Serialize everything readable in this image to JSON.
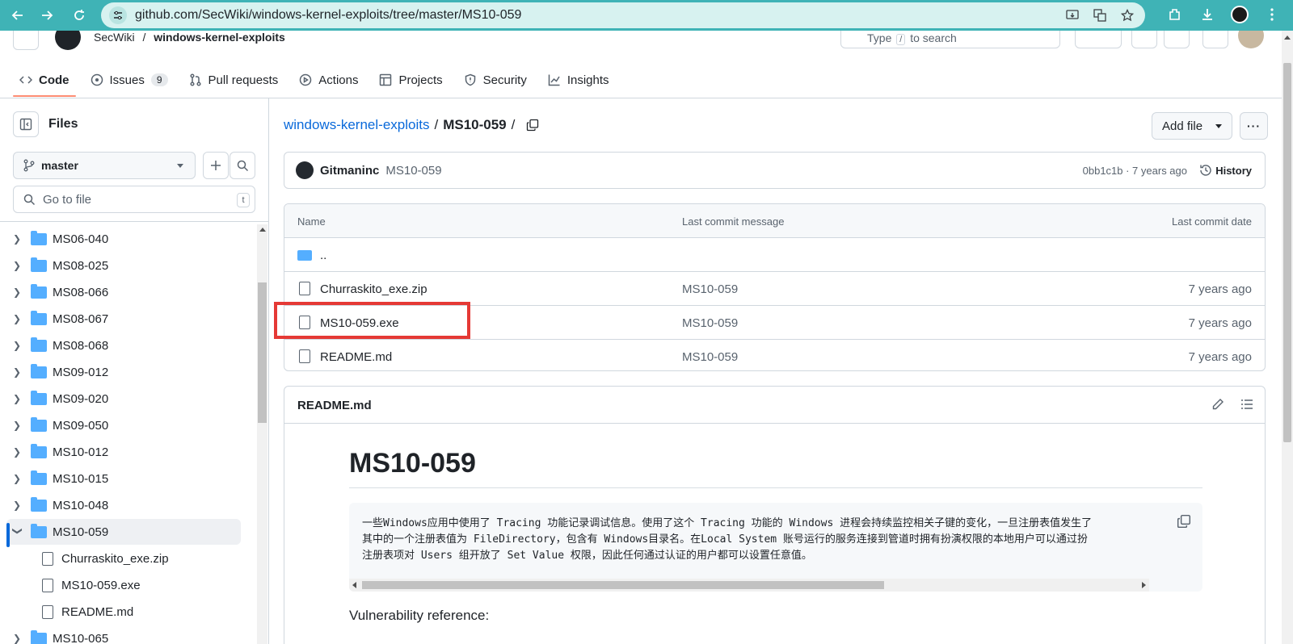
{
  "browser": {
    "url": "github.com/SecWiki/windows-kernel-exploits/tree/master/MS10-059"
  },
  "header": {
    "owner": "SecWiki",
    "separator": "/",
    "repo": "windows-kernel-exploits",
    "search_placeholder_start": "Type",
    "search_key": "/",
    "search_placeholder_end": "to search"
  },
  "tabs": [
    {
      "label": "Code",
      "icon": "code-icon"
    },
    {
      "label": "Issues",
      "icon": "issue-icon",
      "count": "9"
    },
    {
      "label": "Pull requests",
      "icon": "pull-request-icon"
    },
    {
      "label": "Actions",
      "icon": "play-icon"
    },
    {
      "label": "Projects",
      "icon": "table-icon"
    },
    {
      "label": "Security",
      "icon": "shield-icon"
    },
    {
      "label": "Insights",
      "icon": "graph-icon"
    }
  ],
  "sidebar": {
    "title": "Files",
    "branch": "master",
    "goto_placeholder": "Go to file",
    "goto_shortcut": "t",
    "items": [
      {
        "label": "MS06-040",
        "type": "folder"
      },
      {
        "label": "MS08-025",
        "type": "folder"
      },
      {
        "label": "MS08-066",
        "type": "folder"
      },
      {
        "label": "MS08-067",
        "type": "folder"
      },
      {
        "label": "MS08-068",
        "type": "folder"
      },
      {
        "label": "MS09-012",
        "type": "folder"
      },
      {
        "label": "MS09-020",
        "type": "folder"
      },
      {
        "label": "MS09-050",
        "type": "folder"
      },
      {
        "label": "MS10-012",
        "type": "folder"
      },
      {
        "label": "MS10-015",
        "type": "folder"
      },
      {
        "label": "MS10-048",
        "type": "folder"
      },
      {
        "label": "MS10-059",
        "type": "folder-open"
      },
      {
        "label": "Churraskito_exe.zip",
        "type": "file"
      },
      {
        "label": "MS10-059.exe",
        "type": "file"
      },
      {
        "label": "README.md",
        "type": "file"
      },
      {
        "label": "MS10-065",
        "type": "folder"
      }
    ]
  },
  "main": {
    "repo_link": "windows-kernel-exploits",
    "sep": "/",
    "current": "MS10-059",
    "trailing_sep": "/",
    "add_file": "Add file",
    "more": "···",
    "commit": {
      "author": "Gitmaninc",
      "message": "MS10-059",
      "meta": "0bb1c1b · 7 years ago",
      "history": "History"
    },
    "table": {
      "headers": [
        "Name",
        "Last commit message",
        "Last commit date"
      ],
      "parent": "..",
      "rows": [
        {
          "name": "Churraskito_exe.zip",
          "message": "MS10-059",
          "date": "7 years ago"
        },
        {
          "name": "MS10-059.exe",
          "message": "MS10-059",
          "date": "7 years ago"
        },
        {
          "name": "README.md",
          "message": "MS10-059",
          "date": "7 years ago"
        }
      ]
    },
    "readme": {
      "title": "README.md",
      "heading": "MS10-059",
      "code_lines": [
        "一些Windows应用中使用了 Tracing 功能记录调试信息。使用了这个 Tracing 功能的 Windows 进程会持续监控相关子键的变化，一旦注册表值发生了",
        "其中的一个注册表值为 FileDirectory，包含有 Windows目录名。在Local System 账号运行的服务连接到管道时拥有扮演权限的本地用户可以通过扮",
        "注册表项对 Users 组开放了 Set Value 权限，因此任何通过认证的用户都可以设置任意值。"
      ],
      "vuln_ref": "Vulnerability reference:"
    }
  },
  "colors": {
    "chrome": "#3fb3b6",
    "link": "#0969da",
    "highlight": "#e53935",
    "folder": "#54aeff"
  }
}
